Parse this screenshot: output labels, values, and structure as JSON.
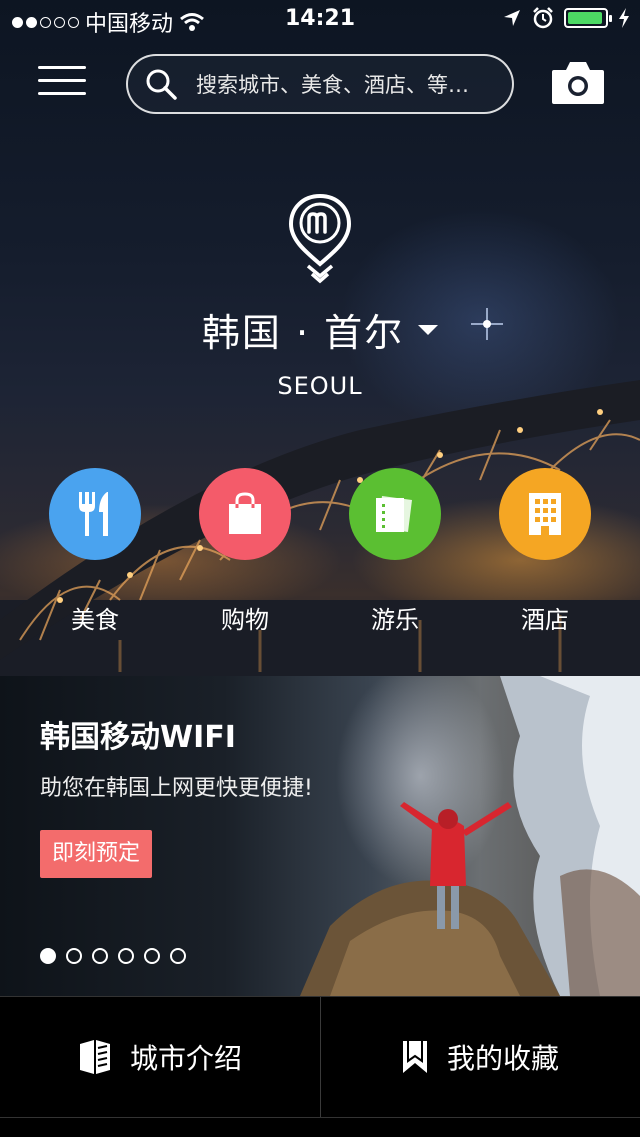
{
  "status_bar": {
    "carrier": "中国移动",
    "time": "14:21",
    "signal_dots": [
      true,
      true,
      false,
      false,
      false
    ],
    "battery_level": 0.85,
    "icons": [
      "wifi-icon",
      "location-arrow-icon",
      "alarm-icon",
      "charging-bolt-icon"
    ]
  },
  "header": {
    "search_placeholder": "搜索城市、美食、酒店、等…",
    "icons": [
      "menu-icon",
      "search-icon",
      "camera-icon"
    ]
  },
  "location": {
    "city_cn": "韩国 · 首尔",
    "city_en": "SEOUL"
  },
  "categories": [
    {
      "label": "美食",
      "icon": "fork-knife-icon",
      "color": "#4aa3ef"
    },
    {
      "label": "购物",
      "icon": "shopping-bag-icon",
      "color": "#f45b6a"
    },
    {
      "label": "游乐",
      "icon": "tickets-icon",
      "color": "#5bbf32"
    },
    {
      "label": "酒店",
      "icon": "building-icon",
      "color": "#f5a623"
    }
  ],
  "banner": {
    "title": "韩国移动WIFI",
    "subtitle": "助您在韩国上网更快更便捷!",
    "button": "即刻预定",
    "button_color": "#f36c6c",
    "page_count": 6,
    "active_page": 1
  },
  "bottom_nav": {
    "city_intro": "城市介绍",
    "favorites": "我的收藏"
  }
}
